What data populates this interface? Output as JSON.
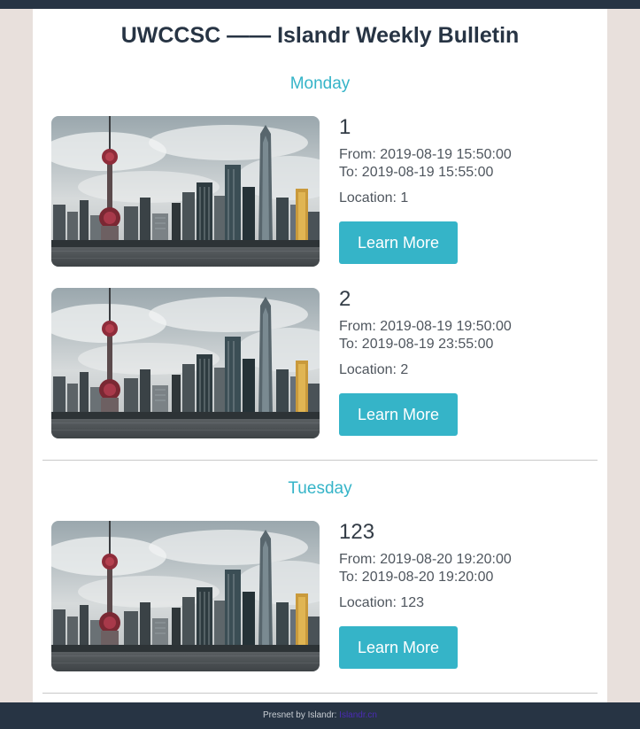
{
  "header": {
    "title": "UWCCSC —— Islandr Weekly Bulletin"
  },
  "days": [
    {
      "name": "Monday",
      "events": [
        {
          "name": "1",
          "from": "From: 2019-08-19 15:50:00",
          "to": "To: 2019-08-19 15:55:00",
          "location": "Location: 1",
          "button": "Learn More"
        },
        {
          "name": "2",
          "from": "From: 2019-08-19 19:50:00",
          "to": "To: 2019-08-19 23:55:00",
          "location": "Location: 2",
          "button": "Learn More"
        }
      ]
    },
    {
      "name": "Tuesday",
      "events": [
        {
          "name": "123",
          "from": "From: 2019-08-20 19:20:00",
          "to": "To: 2019-08-20 19:20:00",
          "location": "Location: 123",
          "button": "Learn More"
        }
      ]
    }
  ],
  "footer": {
    "text": "Presnet by Islandr: ",
    "link_text": "Islandr.cn"
  },
  "colors": {
    "accent": "#35b4c8",
    "dark": "#273444",
    "page_bg": "#e8e0dc"
  }
}
